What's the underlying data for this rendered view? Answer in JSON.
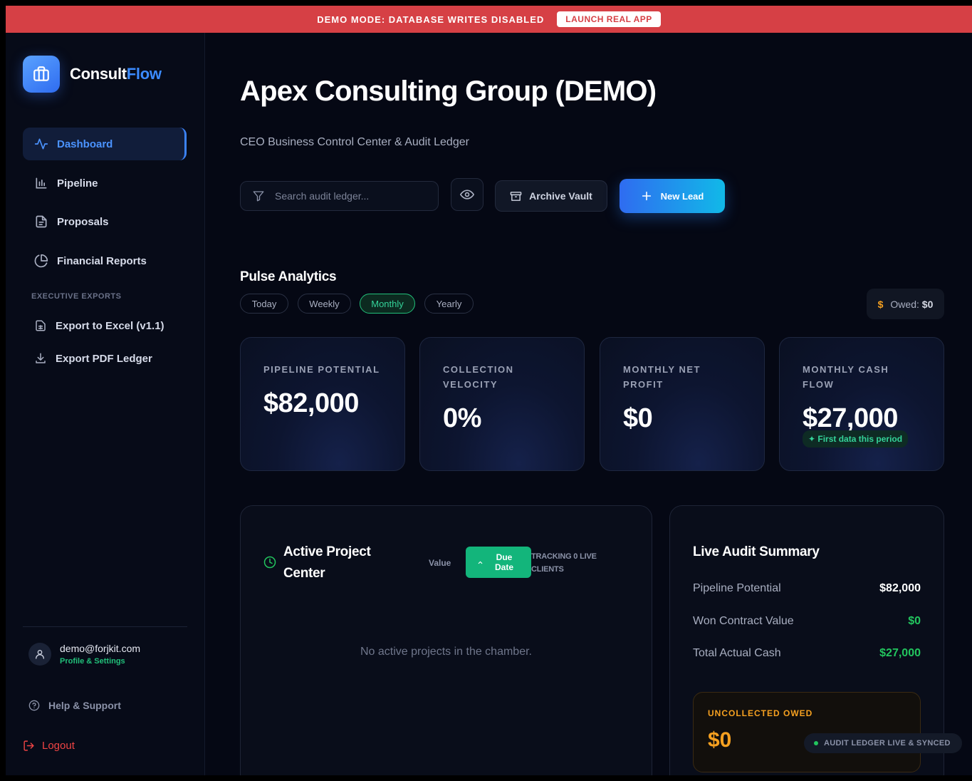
{
  "banner": {
    "text": "DEMO MODE: DATABASE WRITES DISABLED",
    "button": "LAUNCH REAL APP"
  },
  "brand": {
    "name_main": "Consult",
    "name_accent": "Flow"
  },
  "sidebar": {
    "nav": [
      {
        "label": "Dashboard",
        "icon": "activity-icon",
        "active": true
      },
      {
        "label": "Pipeline",
        "icon": "bar-chart-icon"
      },
      {
        "label": "Proposals",
        "icon": "document-icon"
      },
      {
        "label": "Financial Reports",
        "icon": "pie-chart-icon"
      }
    ],
    "section_label": "EXECUTIVE EXPORTS",
    "exports": [
      {
        "label": "Export to Excel (v1.1)",
        "icon": "spreadsheet-icon"
      },
      {
        "label": "Export PDF Ledger",
        "icon": "download-icon"
      }
    ],
    "user": {
      "email": "demo@forjkit.com",
      "link": "Profile & Settings"
    },
    "help": "Help & Support",
    "logout": "Logout"
  },
  "header": {
    "title": "Apex Consulting Group (DEMO)",
    "subtitle": "CEO Business Control Center & Audit Ledger"
  },
  "toolbar": {
    "search_placeholder": "Search audit ledger...",
    "archive_label": "Archive Vault",
    "new_label": "New Lead"
  },
  "pulse": {
    "title": "Pulse Analytics",
    "periods": [
      "Today",
      "Weekly",
      "Monthly",
      "Yearly"
    ],
    "selected_period": "Monthly",
    "owed_label": "Owed:",
    "owed_value": "$0"
  },
  "stats": [
    {
      "label": "PIPELINE POTENTIAL",
      "value": "$82,000"
    },
    {
      "label": "COLLECTION VELOCITY",
      "value": "0%"
    },
    {
      "label": "MONTHLY NET PROFIT",
      "value": "$0"
    },
    {
      "label": "MONTHLY CASH FLOW",
      "value": "$27,000",
      "badge": "✦ First data this period"
    }
  ],
  "projects": {
    "title": "Active Project Center",
    "sort_value": "Value",
    "sort_due": "Due Date",
    "tracking": "TRACKING 0 LIVE CLIENTS",
    "empty": "No active projects in the chamber."
  },
  "audit": {
    "title": "Live Audit Summary",
    "rows": [
      {
        "label": "Pipeline Potential",
        "value": "$82,000"
      },
      {
        "label": "Won Contract Value",
        "value": "$0"
      },
      {
        "label": "Total Actual Cash",
        "value": "$27,000"
      }
    ],
    "uncollected_label": "UNCOLLECTED OWED",
    "uncollected_value": "$0",
    "sync_status": "AUDIT LEDGER LIVE & SYNCED"
  },
  "colors": {
    "accent": "#3b82f6",
    "success": "#22c55e",
    "warning": "#f5a020",
    "danger": "#d64045"
  }
}
